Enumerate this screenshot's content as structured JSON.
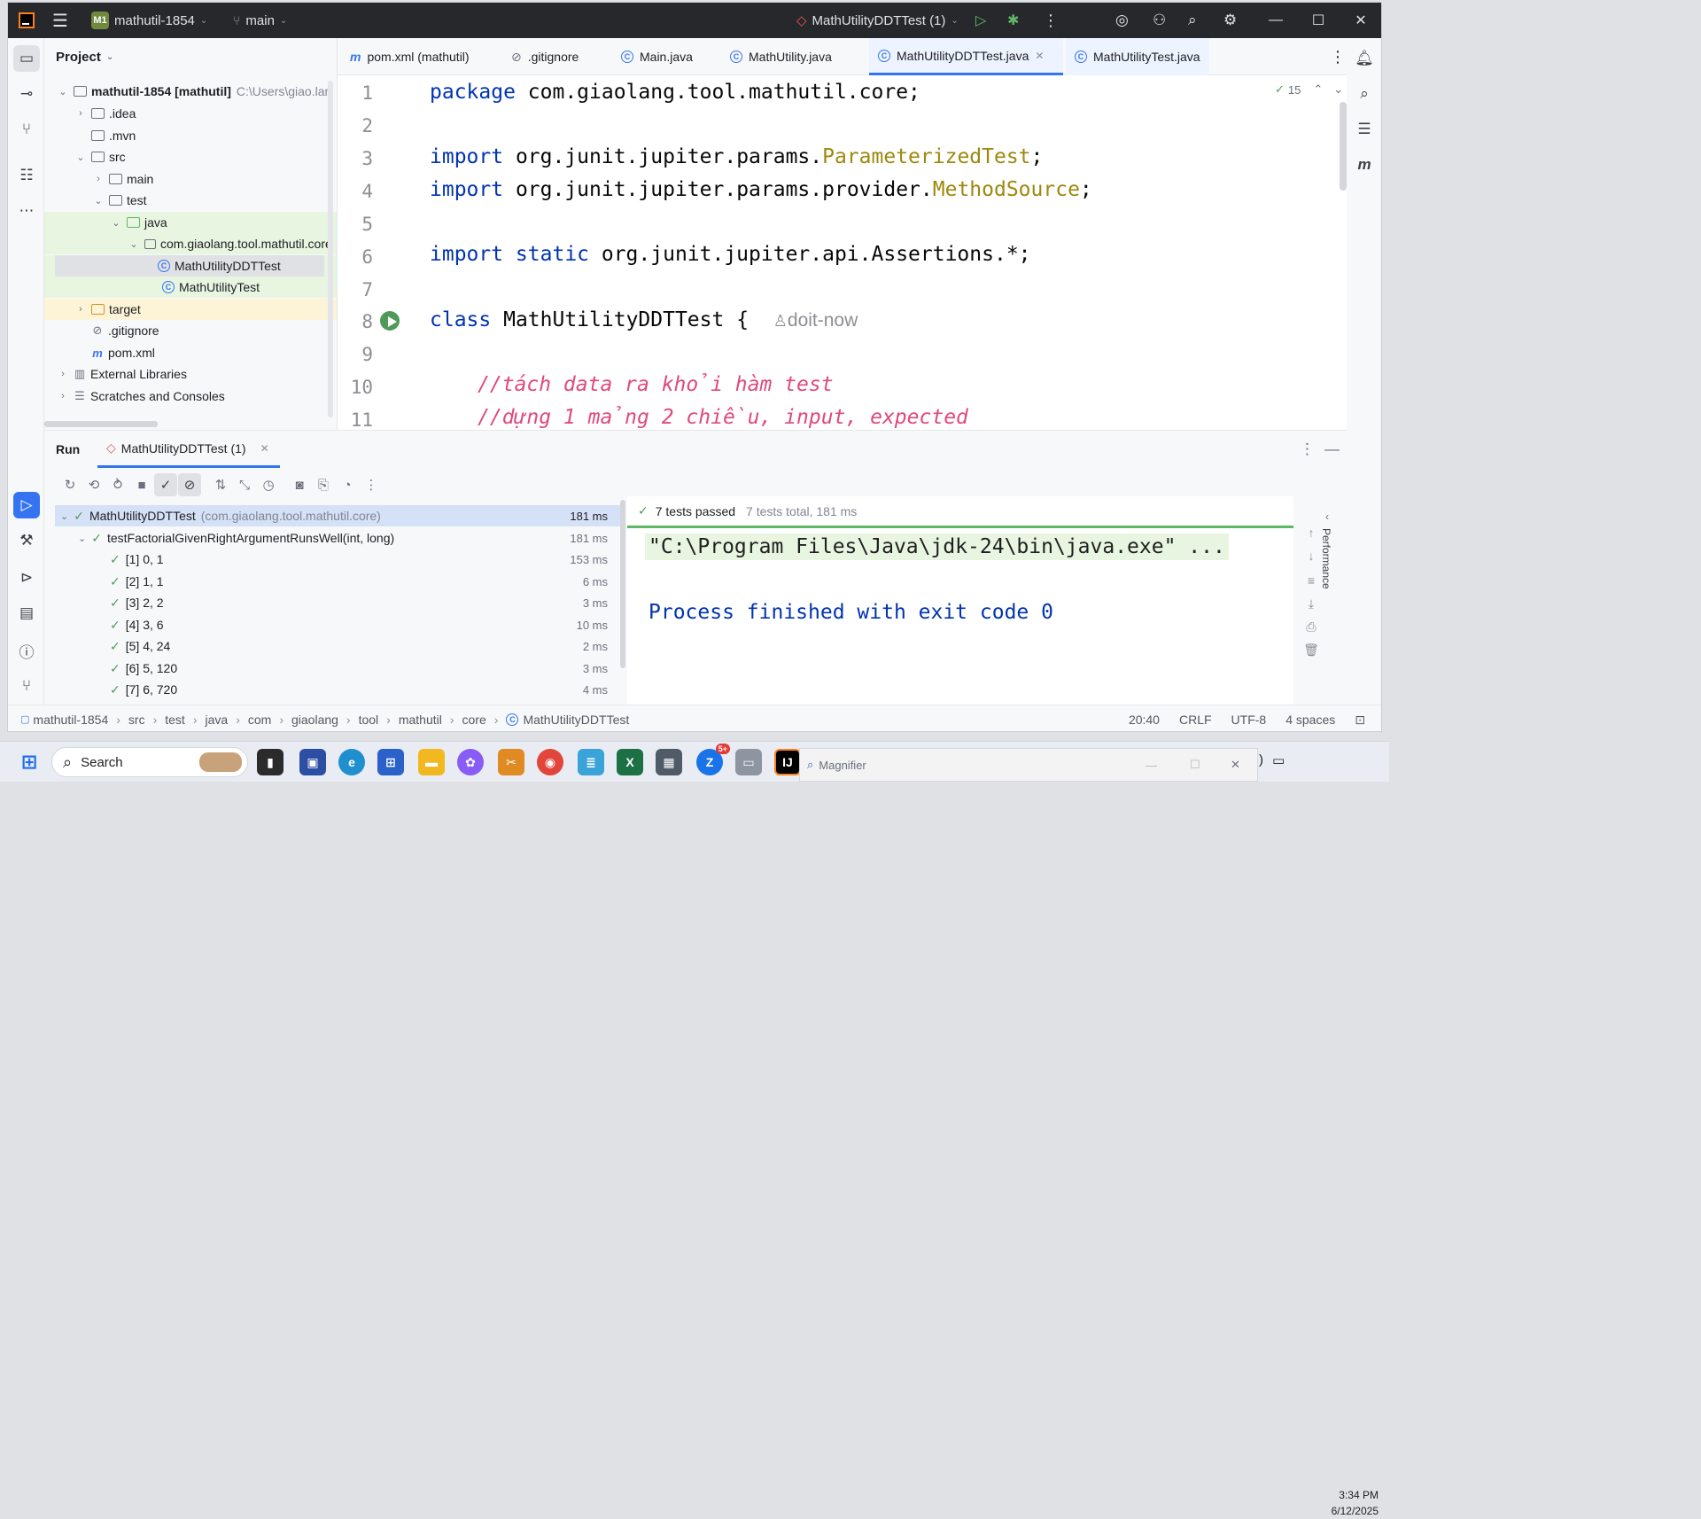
{
  "titlebar": {
    "project_badge": "M1",
    "project_name": "mathutil-1854",
    "branch": "main",
    "run_config": "MathUtilityDDTTest (1)"
  },
  "project_panel": {
    "title": "Project",
    "tree": [
      {
        "label": "mathutil-1854 [mathutil]",
        "hint": "C:\\Users\\giao.lan"
      },
      {
        "label": ".idea"
      },
      {
        "label": ".mvn"
      },
      {
        "label": "src"
      },
      {
        "label": "main"
      },
      {
        "label": "test"
      },
      {
        "label": "java"
      },
      {
        "label": "com.giaolang.tool.mathutil.core"
      },
      {
        "label": "MathUtilityDDTTest"
      },
      {
        "label": "MathUtilityTest"
      },
      {
        "label": "target"
      },
      {
        "label": ".gitignore"
      },
      {
        "label": "pom.xml"
      },
      {
        "label": "External Libraries"
      },
      {
        "label": "Scratches and Consoles"
      }
    ]
  },
  "tabs": [
    {
      "label": "pom.xml (mathutil)"
    },
    {
      "label": ".gitignore"
    },
    {
      "label": "Main.java"
    },
    {
      "label": "MathUtility.java"
    },
    {
      "label": "MathUtilityDDTTest.java"
    },
    {
      "label": "MathUtilityTest.java"
    }
  ],
  "editor": {
    "inspection_count": "15",
    "line_numbers": [
      "1",
      "2",
      "3",
      "4",
      "5",
      "6",
      "7",
      "8",
      "9",
      "10",
      "11"
    ],
    "lines": {
      "l1_kw": "package",
      "l1_rest": " com.giaolang.tool.mathutil.core;",
      "l3_kw": "import",
      "l3_rest": " org.junit.jupiter.params.",
      "l3_cls": "ParameterizedTest",
      "l3_end": ";",
      "l4_kw": "import",
      "l4_rest": " org.junit.jupiter.params.provider.",
      "l4_cls": "MethodSource",
      "l4_end": ";",
      "l6_kw": "import static",
      "l6_rest": " org.junit.jupiter.api.Assertions.*;",
      "l8_kw": "class",
      "l8_rest": " MathUtilityDDTTest {",
      "l8_hint": "doit-now",
      "l10": "//tách data ra khỏi hàm test",
      "l11": "//dựng 1 mảng 2 chiều, input, expected"
    }
  },
  "run_panel": {
    "tab_run": "Run",
    "tab_config": "MathUtilityDDTTest (1)",
    "tests": [
      {
        "name": "MathUtilityDDTTest",
        "pkg": "(com.giaolang.tool.mathutil.core)",
        "time": "181 ms"
      },
      {
        "name": "testFactorialGivenRightArgumentRunsWell(int, long)",
        "time": "181 ms"
      },
      {
        "name": "[1] 0, 1",
        "time": "153 ms"
      },
      {
        "name": "[2] 1, 1",
        "time": "6 ms"
      },
      {
        "name": "[3] 2, 2",
        "time": "3 ms"
      },
      {
        "name": "[4] 3, 6",
        "time": "10 ms"
      },
      {
        "name": "[5] 4, 24",
        "time": "2 ms"
      },
      {
        "name": "[6] 5, 120",
        "time": "3 ms"
      },
      {
        "name": "[7] 6, 720",
        "time": "4 ms"
      }
    ],
    "summary": "7 tests passed",
    "summary_detail": "7 tests total, 181 ms",
    "console_cmd": "\"C:\\Program Files\\Java\\jdk-24\\bin\\java.exe\" ...",
    "console_exit": "Process finished with exit code 0",
    "side_label": "Performance"
  },
  "statusbar": {
    "breadcrumbs": [
      "mathutil-1854",
      "src",
      "test",
      "java",
      "com",
      "giaolang",
      "tool",
      "mathutil",
      "core",
      "MathUtilityDDTTest"
    ],
    "position": "20:40",
    "line_sep": "CRLF",
    "encoding": "UTF-8",
    "indent": "4 spaces"
  },
  "taskbar": {
    "search": "Search",
    "magnifier": "Magnifier",
    "time": "3:34 PM",
    "date": "6/12/2025",
    "zalo_badge": "5+"
  },
  "colors": {
    "accent": "#3574f0",
    "keyword": "#0033b3",
    "annotation": "#9e880d",
    "comment": "#e0497b",
    "pass": "#4f9a59"
  }
}
